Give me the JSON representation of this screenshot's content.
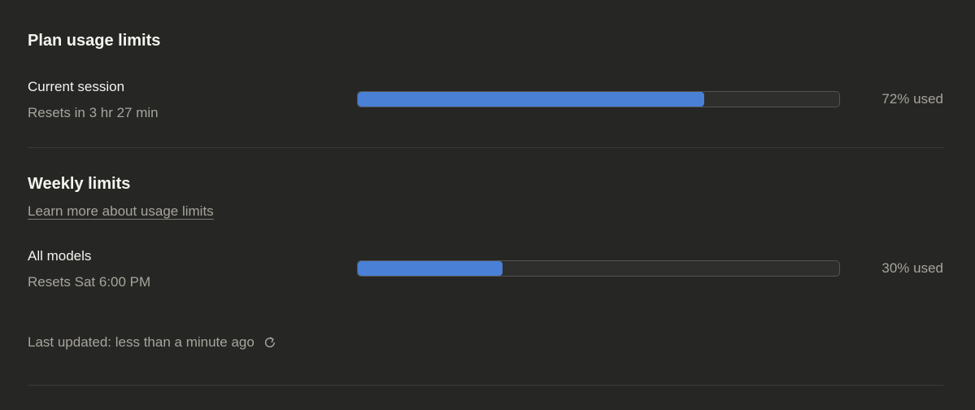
{
  "plan": {
    "title": "Plan usage limits",
    "session": {
      "label": "Current session",
      "reset": "Resets in 3 hr 27 min",
      "usage_fraction": 0.72,
      "usage_text": "72% used"
    }
  },
  "weekly": {
    "title": "Weekly limits",
    "learn_more": "Learn more about usage limits",
    "all_models": {
      "label": "All models",
      "reset": "Resets Sat 6:00 PM",
      "usage_fraction": 0.3,
      "usage_text": "30% used"
    }
  },
  "footer": {
    "last_updated": "Last updated: less than a minute ago",
    "refresh_icon": "refresh-icon"
  },
  "colors": {
    "background": "#262624",
    "bar_fill": "#4a80d6",
    "bar_track": "#2e2e2c",
    "muted_text": "#a6a49c",
    "primary_text": "#f4f3ee"
  }
}
